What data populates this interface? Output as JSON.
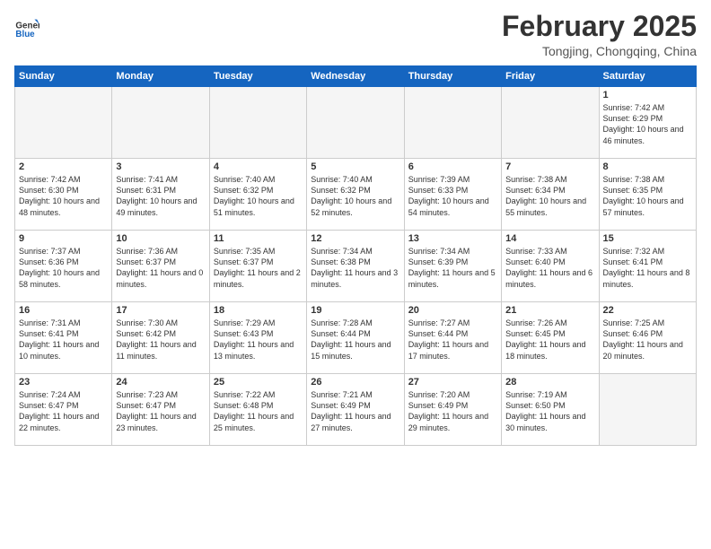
{
  "header": {
    "logo_line1": "General",
    "logo_line2": "Blue",
    "month": "February 2025",
    "location": "Tongjing, Chongqing, China"
  },
  "weekdays": [
    "Sunday",
    "Monday",
    "Tuesday",
    "Wednesday",
    "Thursday",
    "Friday",
    "Saturday"
  ],
  "weeks": [
    [
      {
        "day": "",
        "info": ""
      },
      {
        "day": "",
        "info": ""
      },
      {
        "day": "",
        "info": ""
      },
      {
        "day": "",
        "info": ""
      },
      {
        "day": "",
        "info": ""
      },
      {
        "day": "",
        "info": ""
      },
      {
        "day": "1",
        "info": "Sunrise: 7:42 AM\nSunset: 6:29 PM\nDaylight: 10 hours and 46 minutes."
      }
    ],
    [
      {
        "day": "2",
        "info": "Sunrise: 7:42 AM\nSunset: 6:30 PM\nDaylight: 10 hours and 48 minutes."
      },
      {
        "day": "3",
        "info": "Sunrise: 7:41 AM\nSunset: 6:31 PM\nDaylight: 10 hours and 49 minutes."
      },
      {
        "day": "4",
        "info": "Sunrise: 7:40 AM\nSunset: 6:32 PM\nDaylight: 10 hours and 51 minutes."
      },
      {
        "day": "5",
        "info": "Sunrise: 7:40 AM\nSunset: 6:32 PM\nDaylight: 10 hours and 52 minutes."
      },
      {
        "day": "6",
        "info": "Sunrise: 7:39 AM\nSunset: 6:33 PM\nDaylight: 10 hours and 54 minutes."
      },
      {
        "day": "7",
        "info": "Sunrise: 7:38 AM\nSunset: 6:34 PM\nDaylight: 10 hours and 55 minutes."
      },
      {
        "day": "8",
        "info": "Sunrise: 7:38 AM\nSunset: 6:35 PM\nDaylight: 10 hours and 57 minutes."
      }
    ],
    [
      {
        "day": "9",
        "info": "Sunrise: 7:37 AM\nSunset: 6:36 PM\nDaylight: 10 hours and 58 minutes."
      },
      {
        "day": "10",
        "info": "Sunrise: 7:36 AM\nSunset: 6:37 PM\nDaylight: 11 hours and 0 minutes."
      },
      {
        "day": "11",
        "info": "Sunrise: 7:35 AM\nSunset: 6:37 PM\nDaylight: 11 hours and 2 minutes."
      },
      {
        "day": "12",
        "info": "Sunrise: 7:34 AM\nSunset: 6:38 PM\nDaylight: 11 hours and 3 minutes."
      },
      {
        "day": "13",
        "info": "Sunrise: 7:34 AM\nSunset: 6:39 PM\nDaylight: 11 hours and 5 minutes."
      },
      {
        "day": "14",
        "info": "Sunrise: 7:33 AM\nSunset: 6:40 PM\nDaylight: 11 hours and 6 minutes."
      },
      {
        "day": "15",
        "info": "Sunrise: 7:32 AM\nSunset: 6:41 PM\nDaylight: 11 hours and 8 minutes."
      }
    ],
    [
      {
        "day": "16",
        "info": "Sunrise: 7:31 AM\nSunset: 6:41 PM\nDaylight: 11 hours and 10 minutes."
      },
      {
        "day": "17",
        "info": "Sunrise: 7:30 AM\nSunset: 6:42 PM\nDaylight: 11 hours and 11 minutes."
      },
      {
        "day": "18",
        "info": "Sunrise: 7:29 AM\nSunset: 6:43 PM\nDaylight: 11 hours and 13 minutes."
      },
      {
        "day": "19",
        "info": "Sunrise: 7:28 AM\nSunset: 6:44 PM\nDaylight: 11 hours and 15 minutes."
      },
      {
        "day": "20",
        "info": "Sunrise: 7:27 AM\nSunset: 6:44 PM\nDaylight: 11 hours and 17 minutes."
      },
      {
        "day": "21",
        "info": "Sunrise: 7:26 AM\nSunset: 6:45 PM\nDaylight: 11 hours and 18 minutes."
      },
      {
        "day": "22",
        "info": "Sunrise: 7:25 AM\nSunset: 6:46 PM\nDaylight: 11 hours and 20 minutes."
      }
    ],
    [
      {
        "day": "23",
        "info": "Sunrise: 7:24 AM\nSunset: 6:47 PM\nDaylight: 11 hours and 22 minutes."
      },
      {
        "day": "24",
        "info": "Sunrise: 7:23 AM\nSunset: 6:47 PM\nDaylight: 11 hours and 23 minutes."
      },
      {
        "day": "25",
        "info": "Sunrise: 7:22 AM\nSunset: 6:48 PM\nDaylight: 11 hours and 25 minutes."
      },
      {
        "day": "26",
        "info": "Sunrise: 7:21 AM\nSunset: 6:49 PM\nDaylight: 11 hours and 27 minutes."
      },
      {
        "day": "27",
        "info": "Sunrise: 7:20 AM\nSunset: 6:49 PM\nDaylight: 11 hours and 29 minutes."
      },
      {
        "day": "28",
        "info": "Sunrise: 7:19 AM\nSunset: 6:50 PM\nDaylight: 11 hours and 30 minutes."
      },
      {
        "day": "",
        "info": ""
      }
    ]
  ]
}
